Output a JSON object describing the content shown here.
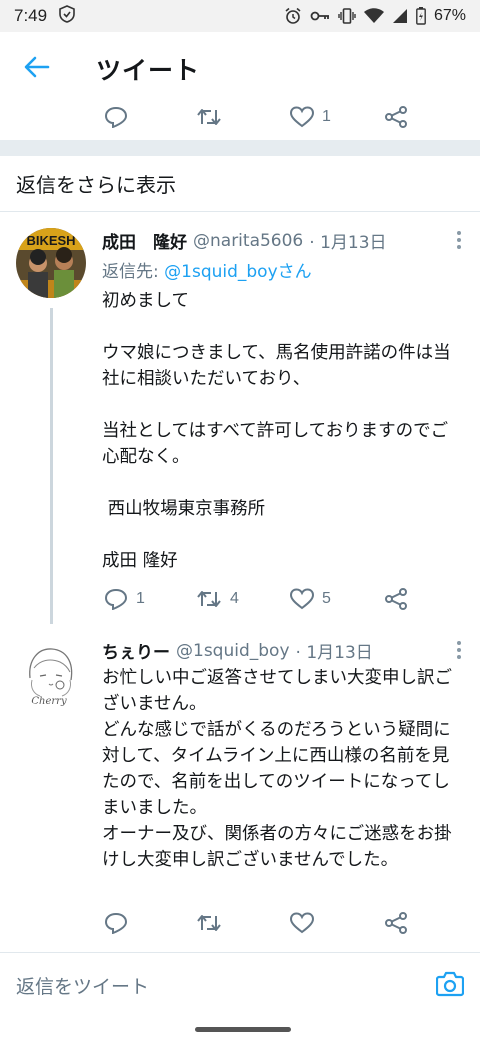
{
  "status_bar": {
    "time": "7:49",
    "battery": "67%",
    "icons": [
      "shield-icon",
      "alarm-icon",
      "key-icon",
      "vibrate-icon",
      "wifi-icon",
      "signal-icon",
      "battery-icon"
    ]
  },
  "app_bar": {
    "title": "ツイート",
    "back_icon": "arrow-left-icon"
  },
  "top_actions": {
    "like_count": "1"
  },
  "show_more_replies": "返信をさらに表示",
  "tweet1": {
    "name": "成田　隆好",
    "handle": "@narita5606",
    "date": "· 1月13日",
    "reply_to_label": "返信先: ",
    "reply_to_user": "@1squid_boyさん",
    "text": "初めまして\n\nウマ娘につきまして、馬名使用許諾の件は当社に相談いただいており、\n\n当社としてはすべて許可しておりますのでご心配なく。\n\n 西山牧場東京事務所\n\n成田 隆好",
    "avatar_banner": "BIKESH",
    "reply_count": "1",
    "retweet_count": "4",
    "like_count": "5"
  },
  "tweet2": {
    "name": "ちぇりー",
    "handle": "@1squid_boy",
    "date": "· 1月13日",
    "text": "お忙しい中ご返答させてしまい大変申し訳ございません。\nどんな感じで話がくるのだろうという疑問に対して、タイムライン上に西山様の名前を見たので、名前を出してのツイートになってしまいました。\nオーナー及び、関係者の方々にご迷惑をお掛けし大変申し訳ございませんでした。",
    "avatar_signature": "Cherry"
  },
  "bottom_bar": {
    "placeholder": "返信をツイート"
  },
  "colors": {
    "accent": "#1da1f2",
    "muted": "#657786",
    "divider": "#e6ecf0"
  }
}
